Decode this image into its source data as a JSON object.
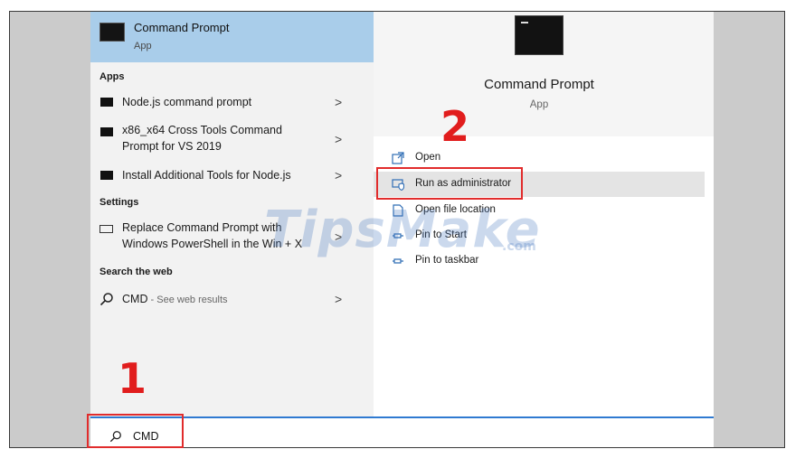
{
  "best_match": {
    "title": "Command Prompt",
    "subtitle": "App"
  },
  "left": {
    "apps_heading": "Apps",
    "apps": [
      {
        "label": "Node.js command prompt"
      },
      {
        "label_line1": "x86_x64 Cross Tools Command",
        "label_line2": "Prompt for VS 2019"
      },
      {
        "label": "Install Additional Tools for Node.js"
      }
    ],
    "settings_heading": "Settings",
    "settings": [
      {
        "label_line1": "Replace Command Prompt with",
        "label_line2": "Windows PowerShell in the Win + X"
      }
    ],
    "web_heading": "Search the web",
    "web": {
      "query": "CMD",
      "suffix": " - See web results"
    },
    "chevron": ">"
  },
  "detail": {
    "title": "Command Prompt",
    "subtitle": "App",
    "actions": [
      {
        "label": "Open",
        "icon": "open-icon"
      },
      {
        "label": "Run as administrator",
        "icon": "shield-icon"
      },
      {
        "label": "Open file location",
        "icon": "folder-icon"
      },
      {
        "label": "Pin to Start",
        "icon": "pin-icon"
      },
      {
        "label": "Pin to taskbar",
        "icon": "pin-icon"
      }
    ]
  },
  "search": {
    "value": "CMD"
  },
  "annotations": {
    "step1": "1",
    "step2": "2",
    "highlight_color": "#e12c2c"
  },
  "watermark": {
    "text": "TipsMake",
    "suffix": ".com"
  },
  "colors": {
    "selected_bg": "#a9cdea",
    "accent": "#2f7ad1"
  }
}
